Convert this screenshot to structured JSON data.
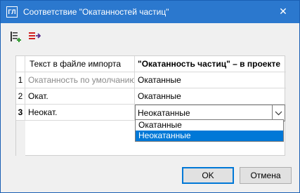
{
  "window": {
    "title": "Соответствие \"Окатанностей частиц\"",
    "app_icon_text": "ГЛ",
    "close_glyph": "✕"
  },
  "toolbar": {
    "icons": [
      "add-rows-icon",
      "delete-rows-icon"
    ]
  },
  "grid": {
    "headers": {
      "import_text": "Текст в файле импорта",
      "project_value": "\"Окатанность частиц\" – в проекте"
    },
    "rows": [
      {
        "num": "1",
        "import_text": "Окатанность по умолчанию",
        "project_value": "Окатанные"
      },
      {
        "num": "2",
        "import_text": "Окат.",
        "project_value": "Окатанные"
      },
      {
        "num": "3",
        "import_text": "Неокат.",
        "project_value": "Неокатанные"
      }
    ]
  },
  "dropdown": {
    "options": [
      "Окатанные",
      "Неокатанные"
    ],
    "selected": "Неокатанные"
  },
  "buttons": {
    "ok": "OK",
    "cancel": "Отмена"
  }
}
